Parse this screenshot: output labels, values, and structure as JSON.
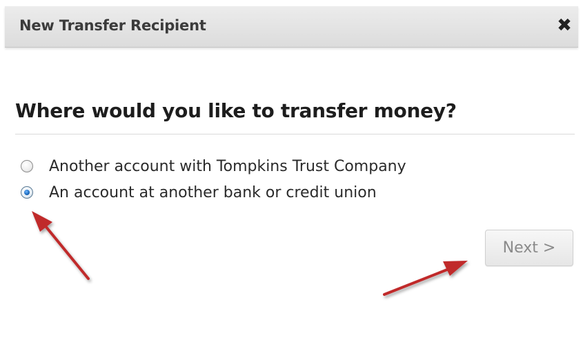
{
  "dialog": {
    "title": "New Transfer Recipient",
    "close_glyph": "✖"
  },
  "main": {
    "heading": "Where would you like to transfer money?",
    "options": [
      {
        "label": "Another account with Tompkins Trust Company",
        "selected": false
      },
      {
        "label": "An account at another bank or credit union",
        "selected": true
      }
    ],
    "next_button_label": "Next >"
  },
  "annotations": {
    "arrow_color": "#c0292b"
  },
  "colors": {
    "titlebar": "#e2e2e2",
    "radio_selected": "#1f6fc2"
  }
}
